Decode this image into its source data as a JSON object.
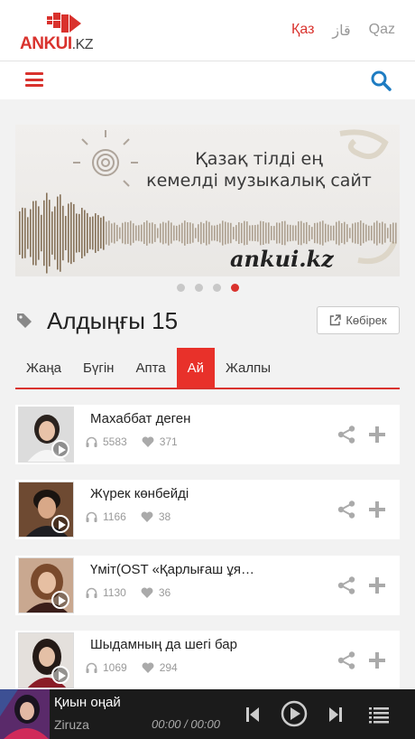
{
  "header": {
    "logo_text": "ANKUI",
    "logo_domain": ".KZ",
    "languages": [
      {
        "label": "Қаз",
        "active": true
      },
      {
        "label": "قاز",
        "active": false
      },
      {
        "label": "Qaz",
        "active": false
      }
    ]
  },
  "banner": {
    "line1": "Қазақ тілді ең",
    "line2": "кемелді музыкалық сайт",
    "url": "ankui.kz",
    "slide_count": 4,
    "active_slide": 4
  },
  "section": {
    "title": "Алдыңғы 15",
    "more_label": "Көбірек"
  },
  "tabs": [
    {
      "label": "Жаңа",
      "active": false
    },
    {
      "label": "Бүгін",
      "active": false
    },
    {
      "label": "Апта",
      "active": false
    },
    {
      "label": "Ай",
      "active": true
    },
    {
      "label": "Жалпы",
      "active": false
    }
  ],
  "songs": [
    {
      "title": "Махаббат деген",
      "listens": "5583",
      "likes": "371"
    },
    {
      "title": "Жүрек көнбейді",
      "listens": "1166",
      "likes": "38"
    },
    {
      "title": "Үміт(OST «Қарлығаш ұя…",
      "listens": "1130",
      "likes": "36"
    },
    {
      "title": "Шыдамның да шегі бар",
      "listens": "1069",
      "likes": "294"
    }
  ],
  "player": {
    "title": "Қиын оңай",
    "artist": "Ziruza",
    "current_time": "00:00",
    "separator": "/",
    "duration": "00:00"
  },
  "colors": {
    "accent": "#d9322d",
    "tab_active": "#e8312a",
    "icon_blue": "#1e7cc2",
    "player_bg": "#1b1b1b"
  },
  "icons": [
    "menu-icon",
    "search-icon",
    "tag-icon",
    "external-link-icon",
    "headphones-icon",
    "heart-icon",
    "share-icon",
    "plus-icon",
    "play-icon",
    "previous-icon",
    "next-icon",
    "playlist-icon"
  ]
}
